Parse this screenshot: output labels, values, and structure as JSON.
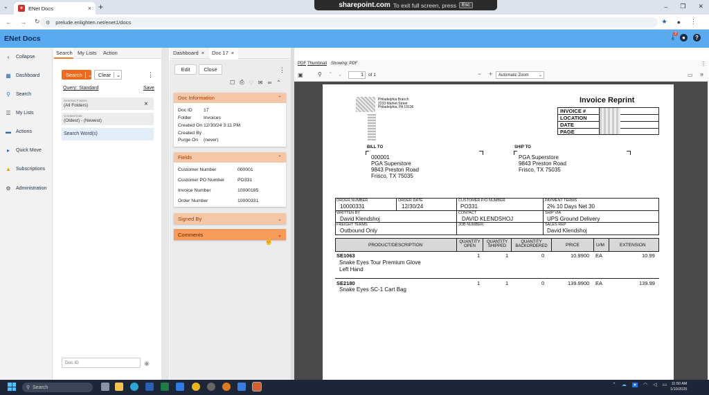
{
  "browser": {
    "tab_title": "ENet Docs",
    "url": "prelude.enlighten.net/enet1/docs",
    "share_overlay": {
      "site": "sharepoint.com",
      "text": "To exit full screen, press",
      "key": "Esc"
    }
  },
  "app": {
    "title": "ENet Docs",
    "notification_count": "2"
  },
  "nav": {
    "collapse": "Collapse",
    "items": [
      "Dashboard",
      "Search",
      "My Lists",
      "Actions",
      "Quick Move",
      "Subscriptions",
      "Administration"
    ]
  },
  "panel": {
    "tabs": [
      "Search",
      "My Lists",
      "Action"
    ],
    "search_btn": "Search",
    "clear_btn": "Clear",
    "query_label": "Query:",
    "query_value": "Standard",
    "save": "Save",
    "folders_label": "Selected Folders",
    "folders_value": "(All Folders)",
    "created_label": "Created Date",
    "created_value": "(Oldest) - (Newest)",
    "search_words": "Search Word(s)",
    "docid_placeholder": "Doc ID"
  },
  "doc": {
    "tabs": [
      "Dashboard",
      "Doc 17"
    ],
    "edit": "Edit",
    "close": "Close",
    "info_title": "Doc Information",
    "info": [
      [
        "Doc ID",
        "17"
      ],
      [
        "Folder",
        "Invoices"
      ],
      [
        "Created On",
        "12/30/24 3:11 PM"
      ],
      [
        "Created By",
        ""
      ],
      [
        "Purge On",
        "(never)"
      ]
    ],
    "fields_title": "Fields",
    "fields": [
      [
        "Customer Number",
        "000001"
      ],
      [
        "Customer PO Number",
        "PO331"
      ],
      [
        "Invoice Number",
        "10000185"
      ],
      [
        "Order Number",
        "10000331"
      ]
    ],
    "signed_by": "Signed By",
    "comments": "Comments"
  },
  "pdf": {
    "links": [
      "PDF",
      "Thumbnail"
    ],
    "showing": "Showing: PDF",
    "page": "1",
    "of": "of 1",
    "zoom": "Automatic Zoom",
    "invoice": {
      "branch": "Philadelphia Branch",
      "addr1": "2233 Market Street",
      "addr2": "Philadelphia, PA  19136",
      "title": "Invoice Reprint",
      "hdr_labels": [
        "INVOICE #",
        "LOCATION",
        "DATE",
        "PAGE"
      ],
      "bill_to_label": "BILL TO",
      "bill_to": [
        "000001",
        "PGA Superstore",
        "9843 Preston Road",
        "Frisco, TX  75035"
      ],
      "ship_to_label": "SHIP TO",
      "ship_to": [
        "PGA Superstore",
        "9843 Preston Road",
        "Frisco, TX  75035"
      ],
      "order_number_label": "ORDER NUMBER",
      "order_number": "10000331",
      "order_date_label": "ORDER DATE",
      "order_date": "12/30/24",
      "cust_po_label": "CUSTOMER P/O NUMBER",
      "cust_po": "PO331",
      "payment_terms_label": "PAYMENT TERMS",
      "payment_terms": "2% 10 Days Net 30",
      "written_by_label": "WRITTEN BY",
      "written_by": "David Klendshoj",
      "contact_label": "CONTACT",
      "contact": "DAVID KLENDSHOJ",
      "ship_via_label": "SHIP VIA",
      "ship_via": "UPS Ground Delivery",
      "freight_label": "FREIGHT TERMS",
      "freight": "Outbound Only",
      "job_label": "JOB NUMBER",
      "sales_rep_label": "SALES REP",
      "sales_rep": "David Klendshoj",
      "cols": [
        "PRODUCT/DESCRIPTION",
        "QUANTITY OPEN",
        "QUANTITY SHIPPED",
        "QUANTITY BACKORDERED",
        "PRICE",
        "U/M",
        "EXTENSION"
      ],
      "lines": [
        {
          "sku": "SE1063",
          "desc": [
            "Snake Eyes Tour Premium Glove",
            "Left Hand"
          ],
          "open": "1",
          "shipped": "1",
          "back": "0",
          "price": "10.9900",
          "um": "EA",
          "ext": "10.99"
        },
        {
          "sku": "SE2180",
          "desc": [
            "Snake Eyes SC-1 Cart Bag"
          ],
          "open": "1",
          "shipped": "1",
          "back": "0",
          "price": "139.9900",
          "um": "EA",
          "ext": "139.99"
        }
      ]
    }
  },
  "taskbar": {
    "search": "Search",
    "time": "11:50 AM",
    "date": "1/10/2025"
  }
}
